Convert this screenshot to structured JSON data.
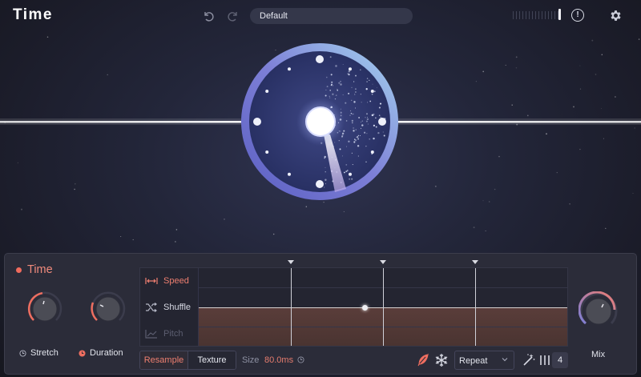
{
  "app": {
    "title": "Time"
  },
  "header": {
    "undo_icon": "undo-icon",
    "redo_icon": "redo-icon",
    "preset": "Default",
    "info_icon": "info-icon",
    "settings_icon": "gear-icon",
    "info_glyph": "!"
  },
  "visual": {
    "type": "radial-time-display",
    "colors": {
      "glow": "#ffffff",
      "ring_start": "#5e62c8",
      "ring_end": "#9fd2ef"
    }
  },
  "panel": {
    "title": "Time",
    "accent": "#ef6b5d",
    "knobs": {
      "stretch": {
        "label": "Stretch",
        "icon": "clock-icon",
        "value": 0.45
      },
      "duration": {
        "label": "Duration",
        "icon": "clock-icon",
        "value": 0.3
      },
      "mix": {
        "label": "Mix",
        "value": 0.4
      }
    },
    "editor": {
      "rows": [
        {
          "label": "Speed",
          "icon": "arrows-expand-icon",
          "state": "active"
        },
        {
          "label": "Shuffle",
          "icon": "shuffle-icon",
          "state": "normal"
        },
        {
          "label": "Pitch",
          "icon": "chart-line-icon",
          "state": "disabled"
        }
      ],
      "level": 0.5
    },
    "bottom": {
      "resample": "Resample",
      "texture": "Texture",
      "size_label": "Size",
      "size_value": "80.0ms",
      "feather_icon": "feather-icon",
      "freeze_icon": "snowflake-icon",
      "mode": "Repeat",
      "wand_icon": "magic-wand-icon",
      "bars_icon": "bars-icon",
      "count": "4"
    }
  }
}
